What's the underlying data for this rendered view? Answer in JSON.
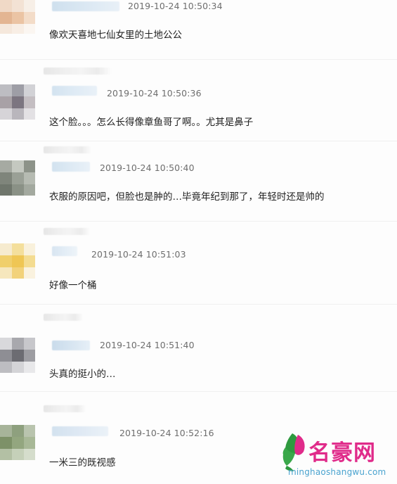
{
  "comments": [
    {
      "timestamp": "2019-10-24 10:50:34",
      "text": "像欢天喜地七仙女里的土地公公"
    },
    {
      "timestamp": "2019-10-24 10:50:36",
      "text": "这个脸。。。怎么长得像章鱼哥了啊。。尤其是鼻子"
    },
    {
      "timestamp": "2019-10-24 10:50:40",
      "text": "衣服的原因吧，但脸也是肿的…毕竟年纪到那了，年轻时还是帅的"
    },
    {
      "timestamp": "2019-10-24 10:51:03",
      "text": "好像一个桶"
    },
    {
      "timestamp": "2019-10-24 10:51:40",
      "text": "头真的挺小的…"
    },
    {
      "timestamp": "2019-10-24 10:52:16",
      "text": "一米三的既视感"
    }
  ],
  "watermark": {
    "title": "名豪网",
    "url": "minghaoshangwu.com"
  },
  "colors": {
    "timestamp": "#6e6e6e",
    "text": "#222222",
    "watermark_title": "#e02b8a",
    "watermark_url": "#4aa3cf"
  }
}
